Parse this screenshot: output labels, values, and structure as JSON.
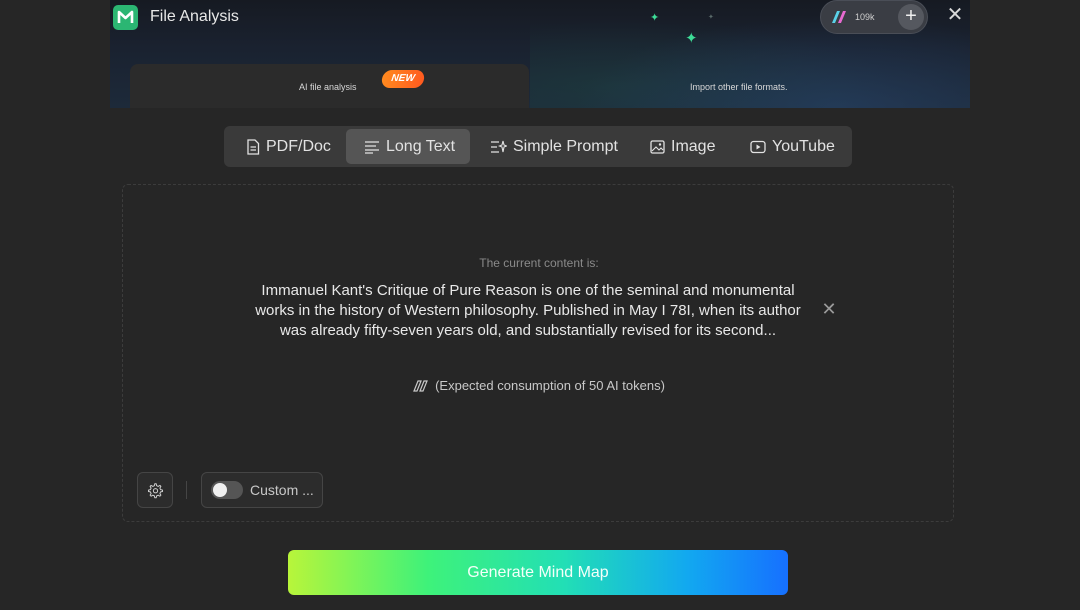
{
  "header": {
    "app_title": "File Analysis",
    "tokens": "109k",
    "tab_ai_label": "AI file analysis",
    "new_badge": "NEW",
    "tab_import_label": "Import other file formats."
  },
  "mode_tabs": [
    {
      "label": "PDF/Doc",
      "icon": "document-icon"
    },
    {
      "label": "Long Text",
      "icon": "text-lines-icon",
      "active": true
    },
    {
      "label": "Simple Prompt",
      "icon": "prompt-icon"
    },
    {
      "label": "Image",
      "icon": "image-icon"
    },
    {
      "label": "YouTube",
      "icon": "youtube-icon"
    }
  ],
  "content": {
    "current_label": "The current content is:",
    "current_text": "Immanuel Kant's Critique of Pure Reason is one of the seminal and monumental works in the history of Western philosophy. Published in May I 78I, when its author was already fifty-seven years old, and substantially revised for its second...",
    "consumption": "(Expected consumption of 50 AI tokens)",
    "custom_label": "Custom ...",
    "custom_enabled": false
  },
  "generate_label": "Generate Mind Map",
  "colors": {
    "accent_green": "#2bb673",
    "badge_orange": "#ff6a1f",
    "gradient_start": "#b8f53a",
    "gradient_end": "#1670ff"
  }
}
